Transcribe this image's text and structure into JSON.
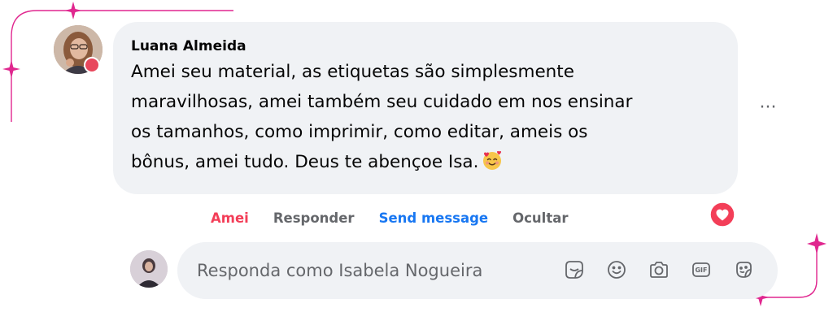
{
  "comment": {
    "author": "Luana Almeida",
    "lines": [
      "Amei seu material, as etiquetas são simplesmente",
      "maravilhosas, amei também seu cuidado em nos ensinar",
      "os tamanhos, como imprimir, como editar, ameis os",
      "bônus, amei tudo. Deus te abençoe Isa."
    ],
    "emoji": "smiling-face-with-hearts-icon",
    "more_label": "···"
  },
  "actions": {
    "like_label": "Amei",
    "reply_label": "Responder",
    "send_label": "Send message",
    "hide_label": "Ocultar"
  },
  "reaction": {
    "icon": "heart-reaction-icon",
    "color": "#f33e58"
  },
  "reply": {
    "placeholder": "Responda como Isabela Nogueira",
    "tools": [
      "sticker-icon",
      "emoji-icon",
      "camera-icon",
      "gif-icon",
      "avatar-sticker-icon"
    ]
  },
  "colors": {
    "accent": "#1877f2",
    "liked": "#f33e58",
    "bubble": "#f0f2f5",
    "frame": "#e0278f"
  }
}
